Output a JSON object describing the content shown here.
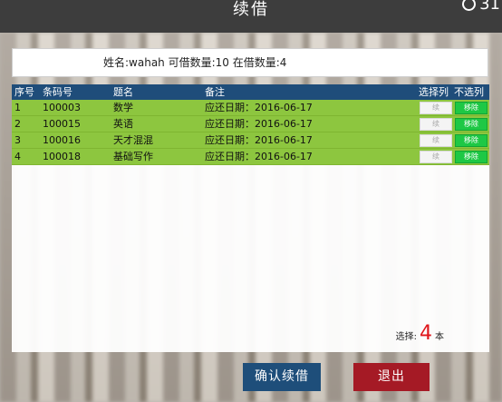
{
  "header": {
    "title": "续借",
    "clock_value": "31"
  },
  "info": {
    "text": "姓名:wahah  可借数量:10  在借数量:4"
  },
  "table": {
    "columns": [
      "序号",
      "条码号",
      "题名",
      "备注",
      "选择列",
      "不选列"
    ],
    "renew_label": "续",
    "remove_label": "移除",
    "rows": [
      {
        "index": "1",
        "barcode": "100003",
        "title": "数学",
        "note": "应还日期：2016-06-17"
      },
      {
        "index": "2",
        "barcode": "100015",
        "title": "英语",
        "note": "应还日期：2016-06-17"
      },
      {
        "index": "3",
        "barcode": "100016",
        "title": "天才混混",
        "note": "应还日期：2016-06-17"
      },
      {
        "index": "4",
        "barcode": "100018",
        "title": "基础写作",
        "note": "应还日期：2016-06-17"
      }
    ]
  },
  "selection": {
    "prefix": "选择:",
    "count": "4",
    "suffix": "本"
  },
  "buttons": {
    "confirm": "确认续借",
    "exit": "退出"
  },
  "colors": {
    "header_bar": "#1f4d7a",
    "row_bg": "#8dc63f",
    "remove_btn": "#1ec845",
    "confirm_btn": "#1e4e7a",
    "exit_btn": "#a51a25",
    "count_red": "#e0161b"
  }
}
